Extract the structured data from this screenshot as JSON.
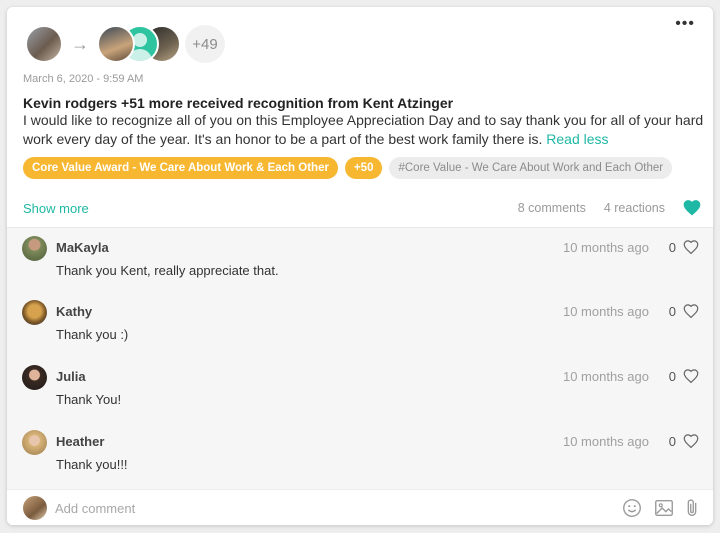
{
  "post": {
    "recipients_overflow": "+49",
    "date": "March 6, 2020 - 9:59 AM",
    "headline": "Kevin rodgers +51 more received recognition from Kent Atzinger",
    "message": "I would like to recognize all of you on this Employee Appreciation Day and to say thank you for all of your hard work every day of the year.  It's an honor to be a part of the best work family there is.",
    "read_less": "Read less",
    "tags": [
      {
        "label": "Core Value Award - We Care About Work & Each Other"
      },
      {
        "label": "+50"
      },
      {
        "label": "#Core Value - We Care About Work and Each Other"
      }
    ],
    "show_more": "Show more",
    "comments_count": "8 comments",
    "reactions_count": "4 reactions",
    "accent_color": "#1fb8a4",
    "tag_color": "#f7b731"
  },
  "comments": [
    {
      "name": "MaKayla",
      "text": "Thank you Kent, really appreciate that.",
      "time": "10 months ago",
      "likes": "0"
    },
    {
      "name": "Kathy",
      "text": "Thank you :)",
      "time": "10 months ago",
      "likes": "0"
    },
    {
      "name": "Julia",
      "text": "Thank You!",
      "time": "10 months ago",
      "likes": "0"
    },
    {
      "name": "Heather",
      "text": "Thank you!!!",
      "time": "10 months ago",
      "likes": "0"
    }
  ],
  "composer": {
    "placeholder": "Add comment",
    "icons": [
      "emoji-icon",
      "image-icon",
      "paperclip-icon"
    ]
  }
}
